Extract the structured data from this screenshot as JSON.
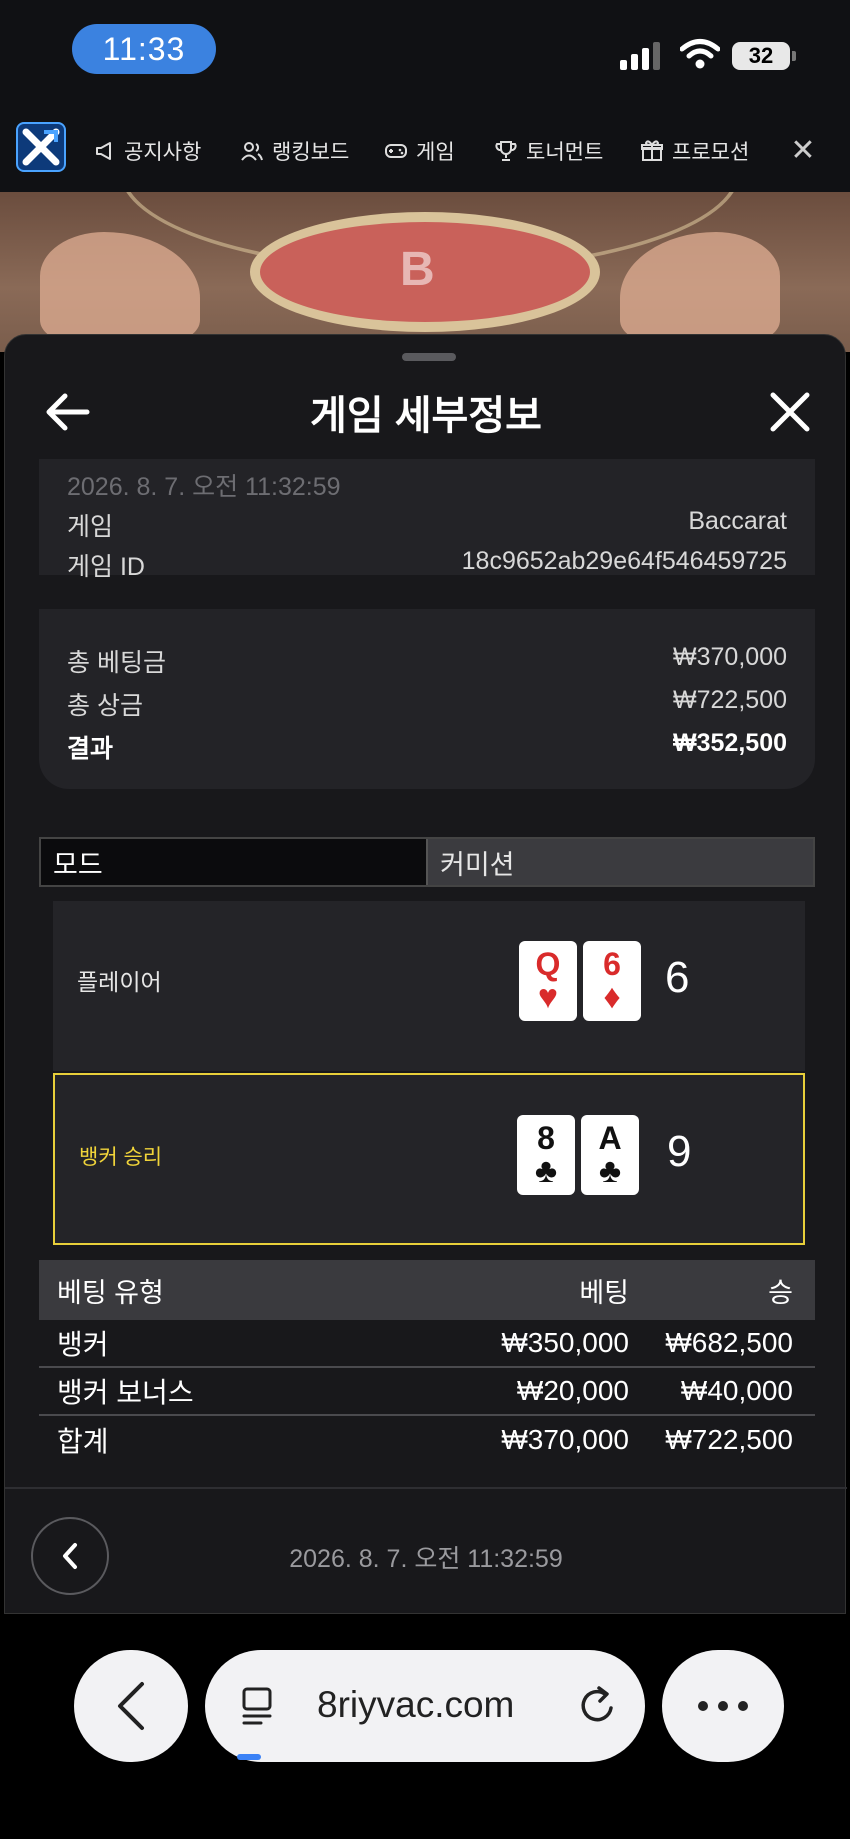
{
  "status": {
    "time": "11:33",
    "battery": "32"
  },
  "nav": {
    "items": [
      {
        "label": "공지사항",
        "icon": "megaphone-icon"
      },
      {
        "label": "랭킹보드",
        "icon": "users-icon"
      },
      {
        "label": "게임",
        "icon": "gamepad-icon"
      },
      {
        "label": "토너먼트",
        "icon": "trophy-icon"
      },
      {
        "label": "프로모션",
        "icon": "gift-icon"
      }
    ],
    "close": "✕"
  },
  "sheet": {
    "title": "게임 세부정보",
    "timestamp_top": "2026. 8. 7. 오전 11:32:59",
    "game_label": "게임",
    "game_value": "Baccarat",
    "game_id_label": "게임 ID",
    "game_id_value": "18c9652ab29e64f546459725",
    "total_bet_label": "총 베팅금",
    "total_bet_value": "₩370,000",
    "total_prize_label": "총 상금",
    "total_prize_value": "₩722,500",
    "result_label": "결과",
    "result_value": "₩352,500",
    "mode_label": "모드",
    "mode_value": "커미션",
    "player": {
      "label": "플레이어",
      "cards": [
        {
          "rank": "Q",
          "suit": "♥"
        },
        {
          "rank": "6",
          "suit": "♦"
        }
      ],
      "total": "6"
    },
    "banker": {
      "label": "뱅커 승리",
      "cards": [
        {
          "rank": "8",
          "suit": "♣"
        },
        {
          "rank": "A",
          "suit": "♣"
        }
      ],
      "total": "9"
    },
    "bets": {
      "headers": {
        "type": "베팅 유형",
        "bet": "베팅",
        "win": "승"
      },
      "rows": [
        {
          "type": "뱅커",
          "bet": "₩350,000",
          "win": "₩682,500"
        },
        {
          "type": "뱅커 보너스",
          "bet": "₩20,000",
          "win": "₩40,000"
        },
        {
          "type": "합계",
          "bet": "₩370,000",
          "win": "₩722,500"
        }
      ]
    },
    "footer_timestamp": "2026. 8. 7. 오전 11:32:59"
  },
  "browser": {
    "url": "8riyvac.com"
  },
  "colors": {
    "accent_blue": "#3b82e0",
    "banker_highlight": "#e8cf3a",
    "card_red": "#d92b2b"
  }
}
